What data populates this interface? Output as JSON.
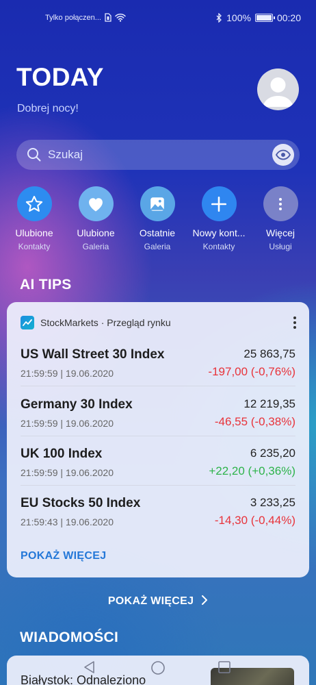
{
  "status_bar": {
    "carrier": "Tylko połączen...",
    "battery": "100%",
    "time": "00:20"
  },
  "header": {
    "title": "TODAY",
    "greeting": "Dobrej nocy!"
  },
  "search": {
    "placeholder": "Szukaj"
  },
  "shortcuts": [
    {
      "label": "Ulubione",
      "sub": "Kontakty",
      "icon": "star-icon",
      "color": "#2d8cf0"
    },
    {
      "label": "Ulubione",
      "sub": "Galeria",
      "icon": "heart-icon",
      "color": "#6fb2ee"
    },
    {
      "label": "Ostatnie",
      "sub": "Galeria",
      "icon": "gallery-icon",
      "color": "#5aa6e6"
    },
    {
      "label": "Nowy kont...",
      "sub": "Kontakty",
      "icon": "plus-icon",
      "color": "#2f86f0"
    },
    {
      "label": "Więcej",
      "sub": "Usługi",
      "icon": "more-icon",
      "color": "#8a8fc6"
    }
  ],
  "ai_tips": {
    "title": "AI TIPS",
    "source": "StockMarkets · Przegląd rynku",
    "rows": [
      {
        "name": "US Wall Street 30 Index",
        "time": "21:59:59 | 19.06.2020",
        "price": "25 863,75",
        "change": "-197,00  (-0,76%)",
        "direction": "down"
      },
      {
        "name": "Germany 30 Index",
        "time": "21:59:59 | 19.06.2020",
        "price": "12 219,35",
        "change": "-46,55  (-0,38%)",
        "direction": "down"
      },
      {
        "name": "UK 100 Index",
        "time": "21:59:59 | 19.06.2020",
        "price": "6 235,20",
        "change": "+22,20  (+0,36%)",
        "direction": "up"
      },
      {
        "name": "EU Stocks 50 Index",
        "time": "21:59:43 | 19.06.2020",
        "price": "3 233,25",
        "change": "-14,30  (-0,44%)",
        "direction": "down"
      }
    ],
    "more": "POKAŻ WIĘCEJ"
  },
  "show_more_all": "POKAŻ WIĘCEJ",
  "news": {
    "title": "WIADOMOŚCI",
    "first_headline": "Białystok: Odnaleziono"
  }
}
